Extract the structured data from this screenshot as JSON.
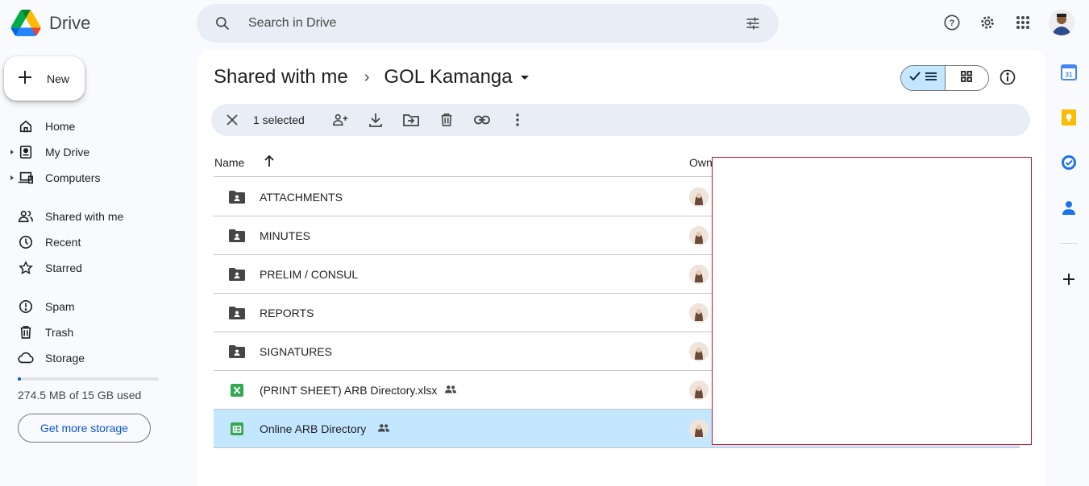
{
  "app": {
    "name": "Drive"
  },
  "search": {
    "placeholder": "Search in Drive"
  },
  "sidebar": {
    "new_label": "New",
    "items": [
      {
        "label": "Home",
        "icon": "home-icon"
      },
      {
        "label": "My Drive",
        "icon": "my-drive-icon"
      },
      {
        "label": "Computers",
        "icon": "computers-icon"
      },
      {
        "label": "Shared with me",
        "icon": "shared-icon"
      },
      {
        "label": "Recent",
        "icon": "clock-icon"
      },
      {
        "label": "Starred",
        "icon": "star-icon"
      },
      {
        "label": "Spam",
        "icon": "spam-icon"
      },
      {
        "label": "Trash",
        "icon": "trash-icon"
      },
      {
        "label": "Storage",
        "icon": "cloud-icon"
      }
    ],
    "storage_text": "274.5 MB of 15 GB used",
    "storage_used_fraction": 0.018,
    "get_storage_label": "Get more storage"
  },
  "breadcrumb": {
    "parent": "Shared with me",
    "current": "GOL Kamanga"
  },
  "selection": {
    "count_label": "1 selected"
  },
  "table": {
    "headers": {
      "name": "Name",
      "owner": "Own"
    },
    "rows": [
      {
        "name": "ATTACHMENTS",
        "type": "shared-folder"
      },
      {
        "name": "MINUTES",
        "type": "shared-folder"
      },
      {
        "name": "PRELIM / CONSUL",
        "type": "shared-folder"
      },
      {
        "name": "REPORTS",
        "type": "shared-folder"
      },
      {
        "name": "SIGNATURES",
        "type": "shared-folder"
      },
      {
        "name": "(PRINT SHEET) ARB Directory.xlsx",
        "type": "excel",
        "shared": true
      },
      {
        "name": "Online ARB Directory",
        "type": "sheets",
        "shared": true,
        "selected": true
      }
    ]
  },
  "colors": {
    "accent": "#0b57d0",
    "selected_bg": "#c2e7ff",
    "searchbar_bg": "#e9eef6"
  }
}
